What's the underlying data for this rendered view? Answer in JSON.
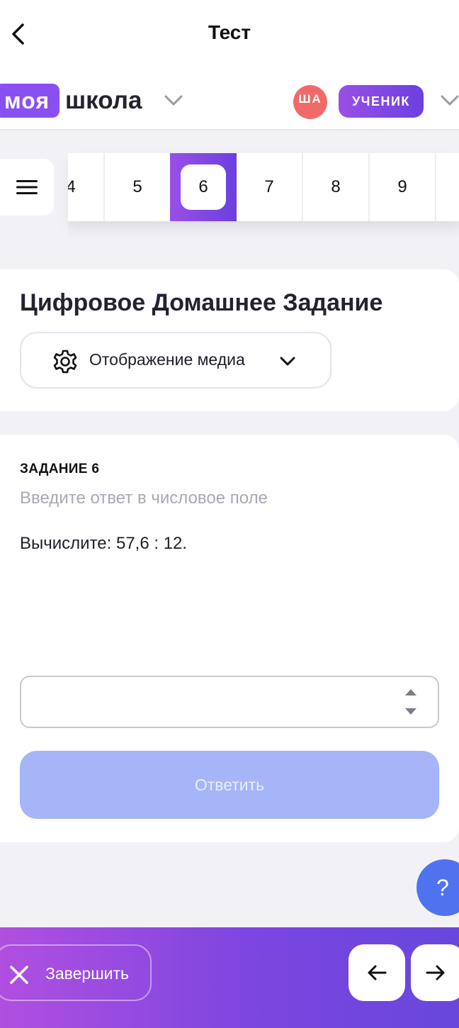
{
  "topbar": {
    "title": "Тест",
    "back_icon": "chevron-left-icon"
  },
  "brand": {
    "logo_part1": "моя",
    "logo_part2": "школа",
    "avatar_initials": "ША",
    "role": "УЧЕНИК",
    "colors": {
      "logo": "#8a4ff0",
      "avatar": "#f06a6a",
      "badge": "#7a45e6"
    }
  },
  "tasks": {
    "items": [
      "4",
      "5",
      "6",
      "7",
      "8",
      "9"
    ],
    "active": "6",
    "menu_icon": "hamburger-menu-icon"
  },
  "homework": {
    "title": "Цифровое Домашнее Задание",
    "media_label": "Отображение медиа",
    "media_icon": "gear-icon"
  },
  "task": {
    "label": "ЗАДАНИЕ 6",
    "hint": "Введите ответ в числовое поле",
    "question": "Вычислите: 57,6 : 12.",
    "answer_value": "",
    "submit_label": "Ответить",
    "submit_color": "#a6b5f7"
  },
  "help": {
    "label": "?",
    "color": "#4f73ee"
  },
  "bottom": {
    "finish_label": "Завершить",
    "finish_icon": "close-icon",
    "prev_icon": "arrow-left-icon",
    "next_icon": "arrow-right-icon"
  }
}
